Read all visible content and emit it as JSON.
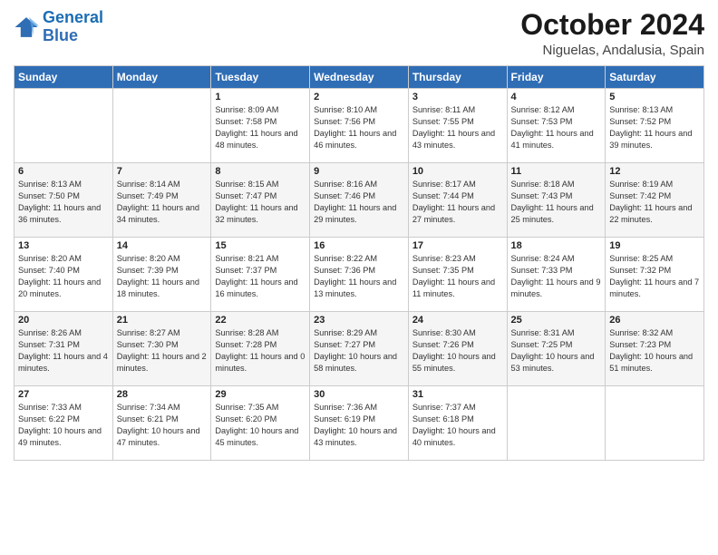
{
  "header": {
    "logo_general": "General",
    "logo_blue": "Blue",
    "month_title": "October 2024",
    "location": "Niguelas, Andalusia, Spain"
  },
  "days_of_week": [
    "Sunday",
    "Monday",
    "Tuesday",
    "Wednesday",
    "Thursday",
    "Friday",
    "Saturday"
  ],
  "weeks": [
    [
      {
        "day": "",
        "sunrise": "",
        "sunset": "",
        "daylight": ""
      },
      {
        "day": "",
        "sunrise": "",
        "sunset": "",
        "daylight": ""
      },
      {
        "day": "1",
        "sunrise": "Sunrise: 8:09 AM",
        "sunset": "Sunset: 7:58 PM",
        "daylight": "Daylight: 11 hours and 48 minutes."
      },
      {
        "day": "2",
        "sunrise": "Sunrise: 8:10 AM",
        "sunset": "Sunset: 7:56 PM",
        "daylight": "Daylight: 11 hours and 46 minutes."
      },
      {
        "day": "3",
        "sunrise": "Sunrise: 8:11 AM",
        "sunset": "Sunset: 7:55 PM",
        "daylight": "Daylight: 11 hours and 43 minutes."
      },
      {
        "day": "4",
        "sunrise": "Sunrise: 8:12 AM",
        "sunset": "Sunset: 7:53 PM",
        "daylight": "Daylight: 11 hours and 41 minutes."
      },
      {
        "day": "5",
        "sunrise": "Sunrise: 8:13 AM",
        "sunset": "Sunset: 7:52 PM",
        "daylight": "Daylight: 11 hours and 39 minutes."
      }
    ],
    [
      {
        "day": "6",
        "sunrise": "Sunrise: 8:13 AM",
        "sunset": "Sunset: 7:50 PM",
        "daylight": "Daylight: 11 hours and 36 minutes."
      },
      {
        "day": "7",
        "sunrise": "Sunrise: 8:14 AM",
        "sunset": "Sunset: 7:49 PM",
        "daylight": "Daylight: 11 hours and 34 minutes."
      },
      {
        "day": "8",
        "sunrise": "Sunrise: 8:15 AM",
        "sunset": "Sunset: 7:47 PM",
        "daylight": "Daylight: 11 hours and 32 minutes."
      },
      {
        "day": "9",
        "sunrise": "Sunrise: 8:16 AM",
        "sunset": "Sunset: 7:46 PM",
        "daylight": "Daylight: 11 hours and 29 minutes."
      },
      {
        "day": "10",
        "sunrise": "Sunrise: 8:17 AM",
        "sunset": "Sunset: 7:44 PM",
        "daylight": "Daylight: 11 hours and 27 minutes."
      },
      {
        "day": "11",
        "sunrise": "Sunrise: 8:18 AM",
        "sunset": "Sunset: 7:43 PM",
        "daylight": "Daylight: 11 hours and 25 minutes."
      },
      {
        "day": "12",
        "sunrise": "Sunrise: 8:19 AM",
        "sunset": "Sunset: 7:42 PM",
        "daylight": "Daylight: 11 hours and 22 minutes."
      }
    ],
    [
      {
        "day": "13",
        "sunrise": "Sunrise: 8:20 AM",
        "sunset": "Sunset: 7:40 PM",
        "daylight": "Daylight: 11 hours and 20 minutes."
      },
      {
        "day": "14",
        "sunrise": "Sunrise: 8:20 AM",
        "sunset": "Sunset: 7:39 PM",
        "daylight": "Daylight: 11 hours and 18 minutes."
      },
      {
        "day": "15",
        "sunrise": "Sunrise: 8:21 AM",
        "sunset": "Sunset: 7:37 PM",
        "daylight": "Daylight: 11 hours and 16 minutes."
      },
      {
        "day": "16",
        "sunrise": "Sunrise: 8:22 AM",
        "sunset": "Sunset: 7:36 PM",
        "daylight": "Daylight: 11 hours and 13 minutes."
      },
      {
        "day": "17",
        "sunrise": "Sunrise: 8:23 AM",
        "sunset": "Sunset: 7:35 PM",
        "daylight": "Daylight: 11 hours and 11 minutes."
      },
      {
        "day": "18",
        "sunrise": "Sunrise: 8:24 AM",
        "sunset": "Sunset: 7:33 PM",
        "daylight": "Daylight: 11 hours and 9 minutes."
      },
      {
        "day": "19",
        "sunrise": "Sunrise: 8:25 AM",
        "sunset": "Sunset: 7:32 PM",
        "daylight": "Daylight: 11 hours and 7 minutes."
      }
    ],
    [
      {
        "day": "20",
        "sunrise": "Sunrise: 8:26 AM",
        "sunset": "Sunset: 7:31 PM",
        "daylight": "Daylight: 11 hours and 4 minutes."
      },
      {
        "day": "21",
        "sunrise": "Sunrise: 8:27 AM",
        "sunset": "Sunset: 7:30 PM",
        "daylight": "Daylight: 11 hours and 2 minutes."
      },
      {
        "day": "22",
        "sunrise": "Sunrise: 8:28 AM",
        "sunset": "Sunset: 7:28 PM",
        "daylight": "Daylight: 11 hours and 0 minutes."
      },
      {
        "day": "23",
        "sunrise": "Sunrise: 8:29 AM",
        "sunset": "Sunset: 7:27 PM",
        "daylight": "Daylight: 10 hours and 58 minutes."
      },
      {
        "day": "24",
        "sunrise": "Sunrise: 8:30 AM",
        "sunset": "Sunset: 7:26 PM",
        "daylight": "Daylight: 10 hours and 55 minutes."
      },
      {
        "day": "25",
        "sunrise": "Sunrise: 8:31 AM",
        "sunset": "Sunset: 7:25 PM",
        "daylight": "Daylight: 10 hours and 53 minutes."
      },
      {
        "day": "26",
        "sunrise": "Sunrise: 8:32 AM",
        "sunset": "Sunset: 7:23 PM",
        "daylight": "Daylight: 10 hours and 51 minutes."
      }
    ],
    [
      {
        "day": "27",
        "sunrise": "Sunrise: 7:33 AM",
        "sunset": "Sunset: 6:22 PM",
        "daylight": "Daylight: 10 hours and 49 minutes."
      },
      {
        "day": "28",
        "sunrise": "Sunrise: 7:34 AM",
        "sunset": "Sunset: 6:21 PM",
        "daylight": "Daylight: 10 hours and 47 minutes."
      },
      {
        "day": "29",
        "sunrise": "Sunrise: 7:35 AM",
        "sunset": "Sunset: 6:20 PM",
        "daylight": "Daylight: 10 hours and 45 minutes."
      },
      {
        "day": "30",
        "sunrise": "Sunrise: 7:36 AM",
        "sunset": "Sunset: 6:19 PM",
        "daylight": "Daylight: 10 hours and 43 minutes."
      },
      {
        "day": "31",
        "sunrise": "Sunrise: 7:37 AM",
        "sunset": "Sunset: 6:18 PM",
        "daylight": "Daylight: 10 hours and 40 minutes."
      },
      {
        "day": "",
        "sunrise": "",
        "sunset": "",
        "daylight": ""
      },
      {
        "day": "",
        "sunrise": "",
        "sunset": "",
        "daylight": ""
      }
    ]
  ]
}
